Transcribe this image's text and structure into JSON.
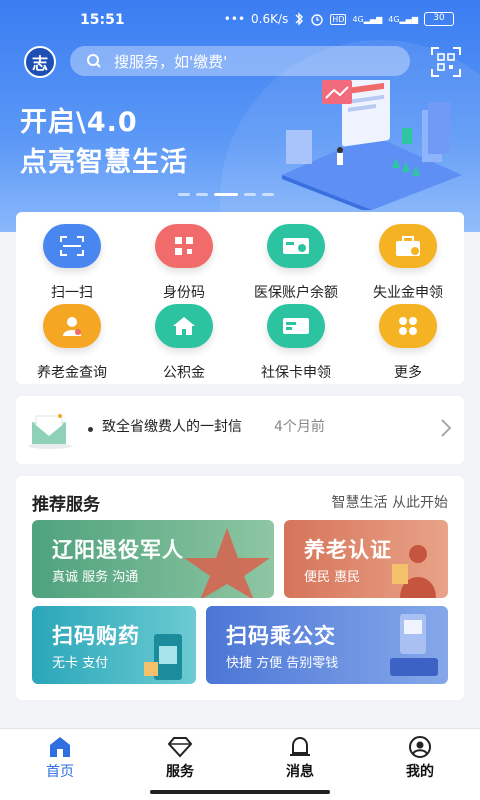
{
  "status_bar": {
    "time": "15:51",
    "dots": "•••",
    "speed": "0.6K/s",
    "bluetooth_icon": "bluetooth-icon",
    "alarm_icon": "alarm-icon",
    "hd": "HD",
    "signal1": "4G",
    "signal2": "4G",
    "battery": "30"
  },
  "header": {
    "logo_text": "志",
    "search_placeholder": "搜服务，如'缴费'",
    "scan_icon": "qr-scan-icon"
  },
  "banner": {
    "line1": "开启\\4.0",
    "line2": "点亮智慧生活",
    "slides": 5,
    "active_slide": 2
  },
  "grid": [
    {
      "label": "扫一扫",
      "icon": "scan-icon",
      "color": "#4a86f0"
    },
    {
      "label": "身份码",
      "icon": "id-code-icon",
      "color": "#f26b6b"
    },
    {
      "label": "医保账户余额",
      "icon": "medical-card-icon",
      "color": "#2cc4a0"
    },
    {
      "label": "失业金申领",
      "icon": "unemployment-icon",
      "color": "#f5b323"
    },
    {
      "label": "养老金查询",
      "icon": "pension-icon",
      "color": "#f5a623"
    },
    {
      "label": "公积金",
      "icon": "housing-fund-icon",
      "color": "#2cc4a0"
    },
    {
      "label": "社保卡申领",
      "icon": "social-card-icon",
      "color": "#2cc4a0"
    },
    {
      "label": "更多",
      "icon": "more-icon",
      "color": "#f5b323"
    }
  ],
  "notice": {
    "title": "致全省缴费人的一封信",
    "time": "4个月前"
  },
  "recommend": {
    "title": "推荐服务",
    "subtitle": "智慧生活 从此开始",
    "tiles": [
      {
        "title": "辽阳退役军人",
        "sub": "真诚 服务 沟通"
      },
      {
        "title": "养老认证",
        "sub": "便民 惠民"
      },
      {
        "title": "扫码购药",
        "sub": "无卡 支付"
      },
      {
        "title": "扫码乘公交",
        "sub": "快捷 方便 告别零钱"
      }
    ]
  },
  "nav": [
    {
      "label": "首页",
      "icon": "home-icon"
    },
    {
      "label": "服务",
      "icon": "diamond-icon"
    },
    {
      "label": "消息",
      "icon": "bell-icon"
    },
    {
      "label": "我的",
      "icon": "profile-icon"
    }
  ]
}
